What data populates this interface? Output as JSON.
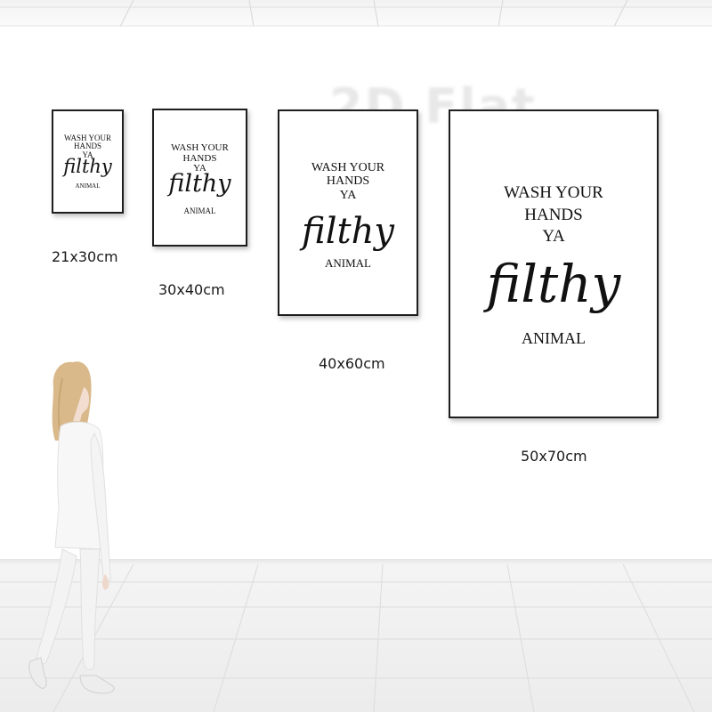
{
  "watermark": "2D Flat",
  "poster_text": {
    "line1": "WASH YOUR",
    "line2": "HANDS",
    "line3": "YA",
    "script_word": "filthy",
    "last_word": "ANIMAL"
  },
  "posters": [
    {
      "size_label": "21x30cm"
    },
    {
      "size_label": "30x40cm"
    },
    {
      "size_label": "40x60cm"
    },
    {
      "size_label": "50x70cm"
    }
  ],
  "colors": {
    "wall": "#ffffff",
    "floor": "#eeeeee",
    "frame": "#1e1e1e",
    "text": "#111111"
  }
}
